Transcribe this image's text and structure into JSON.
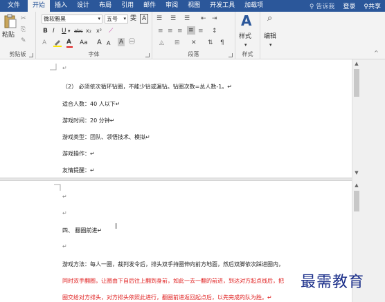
{
  "menubar": {
    "tabs": [
      "文件",
      "开始",
      "插入",
      "设计",
      "布局",
      "引用",
      "邮件",
      "审阅",
      "视图",
      "开发工具",
      "加载项"
    ],
    "active_tab": "开始",
    "tell_me": "告诉我",
    "login": "登录",
    "share": "共享"
  },
  "ribbon": {
    "clipboard": {
      "paste_label": "粘贴",
      "group_label": "剪贴板"
    },
    "font": {
      "font_name": "微软雅黑",
      "font_size": "五号",
      "bold": "B",
      "italic": "I",
      "underline": "U",
      "strike": "abc",
      "subscript": "x₂",
      "superscript": "x²",
      "font_color_glyph": "A",
      "grow_font": "A",
      "shrink_font": "A",
      "case": "Aa",
      "group_label": "字体"
    },
    "paragraph": {
      "group_label": "段落"
    },
    "styles": {
      "label": "样式",
      "group_label": "样式"
    },
    "editing": {
      "label": "编辑"
    }
  },
  "document": {
    "page1": {
      "lines": [
        {
          "text": "↵",
          "style": "para"
        },
        {
          "text": "（2）    必须依次循环钻圈，不能少钻或漏钻。钻圈次数=总人数-1。↵",
          "style": "normal"
        },
        {
          "text": "适合人数：40 人以下↵",
          "style": "normal"
        },
        {
          "text": "游戏时间：20 分钟↵",
          "style": "normal"
        },
        {
          "text": "游戏类型：团队、领悟技术、模拟↵",
          "style": "normal"
        },
        {
          "text": "游戏操作：↵",
          "style": "normal"
        },
        {
          "text": "友情提醒：↵",
          "style": "normal"
        }
      ]
    },
    "page2": {
      "lines": [
        {
          "text": "↵",
          "style": "para"
        },
        {
          "text": "↵",
          "style": "para"
        },
        {
          "text": "四、   翻圈前进↵",
          "style": "normal"
        },
        {
          "text": "↵",
          "style": "para"
        },
        {
          "text": "游戏方法：每人一圈，裁判发令后，排头双手持圈伸向前方地面，然后双脚依次踩进圈内，",
          "style": "normal"
        },
        {
          "text": "同时双手翻圈，让圈由下自后往上翻到身前，如此一去一翻的前进，到达对方起点线后，把",
          "style": "red"
        },
        {
          "text": "圈交给对方排头，对方排头依照此进行，翻圈前进返回起点后，以先完成的队为胜。↵",
          "style": "red"
        }
      ]
    }
  },
  "watermark": "最需教育"
}
